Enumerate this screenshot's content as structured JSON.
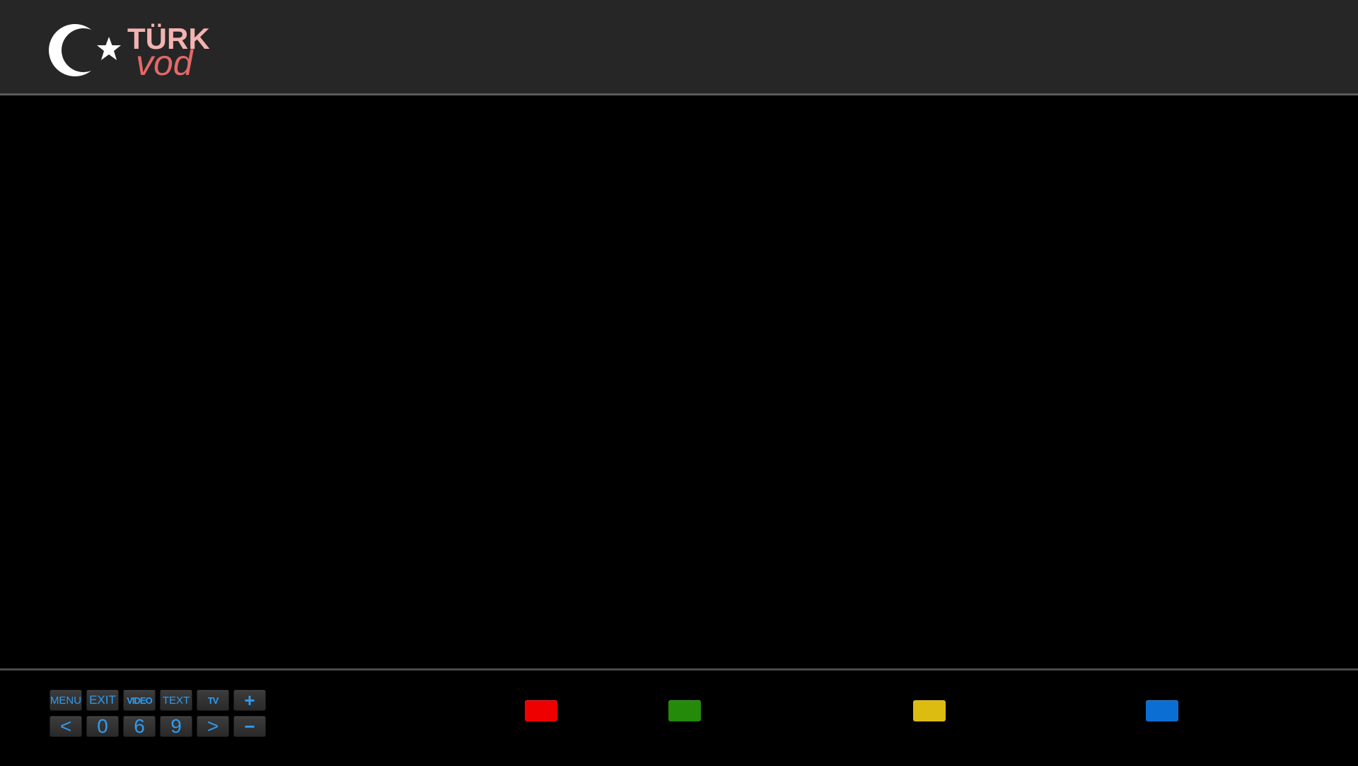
{
  "header": {
    "logo": {
      "text_top": "TÜRK",
      "text_bottom": "vod",
      "emblem_icon": "crescent-star-icon",
      "colors": {
        "top": "#f3b3b1",
        "bottom": "#e66868",
        "emblem": "#ffffff"
      }
    }
  },
  "footer": {
    "keys_row1": [
      "MENU",
      "EXIT",
      "VIDEO",
      "TEXT",
      "TV",
      "+"
    ],
    "keys_row2": [
      "<",
      "0",
      "6",
      "9",
      ">",
      "−"
    ],
    "color_buttons": [
      {
        "name": "red",
        "color": "#ee0000"
      },
      {
        "name": "green",
        "color": "#238a0a"
      },
      {
        "name": "yellow",
        "color": "#dcbc10"
      },
      {
        "name": "blue",
        "color": "#0a6ed2"
      }
    ]
  },
  "colors": {
    "header_bg": "#262626",
    "main_bg": "#000000",
    "key_text": "#2f9bf0"
  }
}
